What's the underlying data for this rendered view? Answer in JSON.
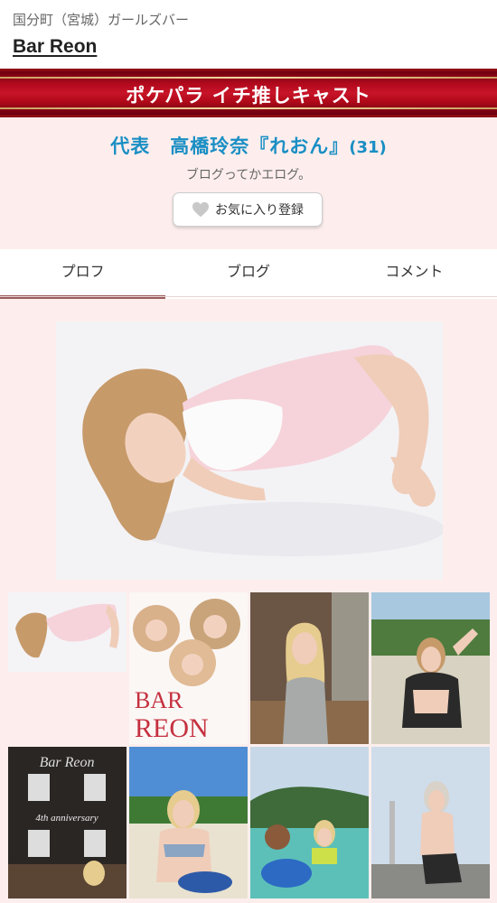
{
  "header": {
    "area": "国分町（宮城）ガールズバー",
    "shop_name": "Bar Reon"
  },
  "banner": {
    "title": "ポケパラ イチ推しキャスト"
  },
  "cast": {
    "name": "代表　高橋玲奈『れおん』",
    "age": "(31)",
    "catchphrase": "ブログってかエログ。",
    "favorite_label": "お気に入り登録"
  },
  "tabs": [
    {
      "label": "プロフ",
      "active": true
    },
    {
      "label": "ブログ",
      "active": false
    },
    {
      "label": "コメント",
      "active": false
    }
  ],
  "thumbnails": {
    "poster_text_1": "BAR",
    "poster_text_2": "REON",
    "anniv_title": "Bar Reon",
    "anniv_text": "4th anniversary"
  },
  "colors": {
    "page_bg": "#fdeeed",
    "banner_red": "#c81428",
    "name_blue": "#1a8fc4",
    "tab_active": "#9a5b5b"
  }
}
